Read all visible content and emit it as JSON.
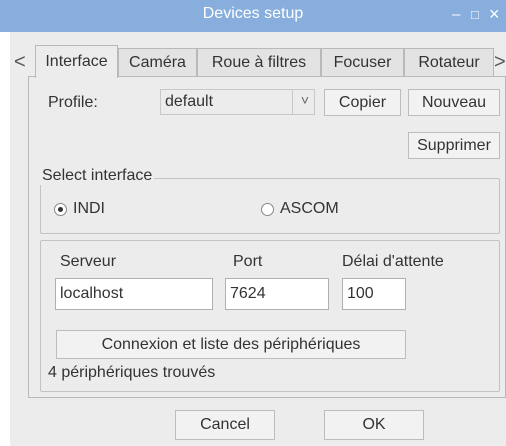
{
  "window": {
    "title": "Devices setup",
    "minimize_glyph": "–",
    "maximize_glyph": "□",
    "close_glyph": "×"
  },
  "tabs": [
    {
      "label": "Interface",
      "active": true
    },
    {
      "label": "Caméra",
      "active": false
    },
    {
      "label": "Roue à filtres",
      "active": false
    },
    {
      "label": "Focuser",
      "active": false
    },
    {
      "label": "Rotateur",
      "active": false
    }
  ],
  "tab_scroll": {
    "left": "<",
    "right": ">"
  },
  "profile": {
    "label": "Profile:",
    "value": "default",
    "dropdown_glyph": "˅",
    "copy_label": "Copier",
    "new_label": "Nouveau",
    "delete_label": "Supprimer"
  },
  "interface_group": {
    "title": "Select interface",
    "options": [
      {
        "label": "INDI",
        "selected": true
      },
      {
        "label": "ASCOM",
        "selected": false
      }
    ]
  },
  "connection": {
    "server_label": "Serveur",
    "server_value": "localhost",
    "port_label": "Port",
    "port_value": "7624",
    "timeout_label": "Délai d'attente",
    "timeout_value": "100",
    "connect_label": "Connexion et liste des périphériques",
    "status": "4 périphériques trouvés"
  },
  "footer": {
    "cancel_label": "Cancel",
    "ok_label": "OK"
  },
  "colors": {
    "titlebar": "#87aedc",
    "background": "#ececec"
  }
}
